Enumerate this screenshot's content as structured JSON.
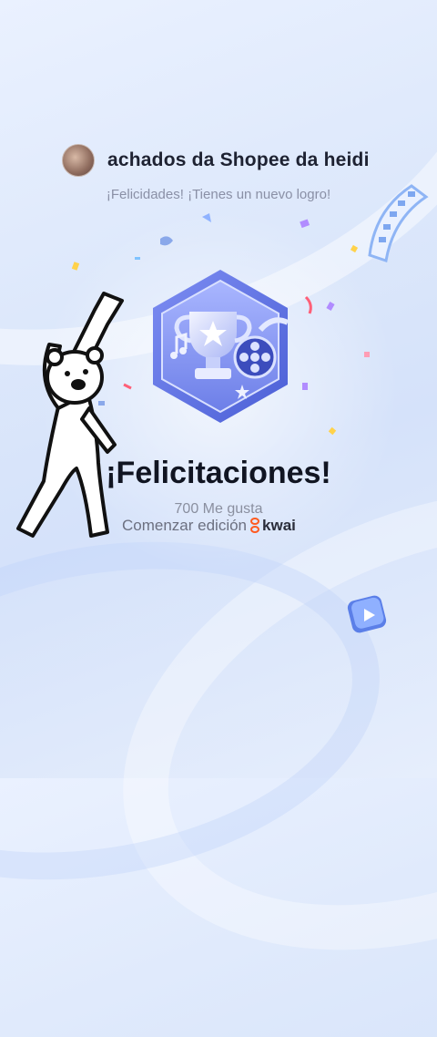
{
  "header": {
    "username": "achados da Shopee da heidi"
  },
  "achievement": {
    "subtitle": "¡Felicidades! ¡Tienes un nuevo logro!",
    "title": "¡Felicitaciones!",
    "likes_text": "700 Me gusta",
    "edit_label": "Comenzar edición",
    "brand": "kwai"
  },
  "colors": {
    "badge_primary": "#5b6ee0",
    "badge_light": "#c9d3ff",
    "brand_orange": "#ff5a1f",
    "title_text": "#111522"
  },
  "icons": [
    "avatar",
    "trophy-badge-icon",
    "star-icon",
    "film-reel-icon",
    "music-note-icon",
    "film-strip-icon",
    "play-icon",
    "dancing-bear-sticker"
  ]
}
